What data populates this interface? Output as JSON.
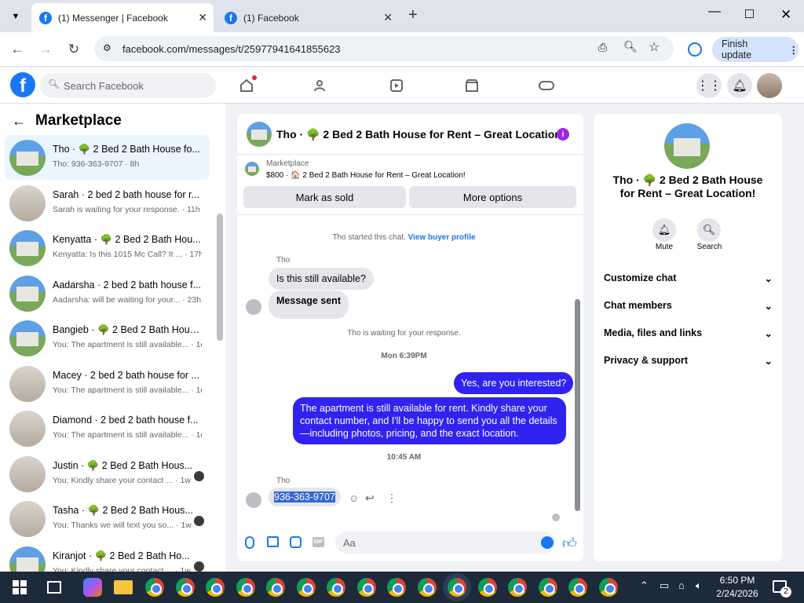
{
  "browser": {
    "tabs": [
      {
        "title": "(1) Messenger | Facebook"
      },
      {
        "title": "(1) Facebook"
      }
    ],
    "url": "facebook.com/messages/t/25977941641855623",
    "finish_update": "Finish update"
  },
  "fb": {
    "search_placeholder": "Search Facebook"
  },
  "left": {
    "title": "Marketplace",
    "conversations": [
      {
        "name": "Tho · 🌳 2 Bed 2 Bath House fo...",
        "preview": "Tho: 936-363-9707 · 8h"
      },
      {
        "name": "Sarah · 2 bed 2 bath house for r...",
        "preview": "Sarah is waiting for your response. · 11h"
      },
      {
        "name": "Kenyatta · 🌳 2 Bed 2 Bath Hou...",
        "preview": "Kenyatta: Is this 1015 Mc Call? It ... · 17h"
      },
      {
        "name": "Aadarsha · 2 bed 2 bath house f...",
        "preview": "Aadarsha: will be waiting for your... · 23h"
      },
      {
        "name": "Bangieb · 🌳 2 Bed 2 Bath Hous...",
        "preview": "You: The apartment is still available... · 1d"
      },
      {
        "name": "Macey · 2 bed 2 bath house for ...",
        "preview": "You: The apartment is still available... · 1d"
      },
      {
        "name": "Diamond · 2 bed 2 bath house f...",
        "preview": "You: The apartment is still available... · 1d"
      },
      {
        "name": "Justin · 🌳 2 Bed 2 Bath Hous...",
        "preview": "You: Kindly share your contact ... · 1w"
      },
      {
        "name": "Tasha · 🌳 2 Bed 2 Bath Hous...",
        "preview": "You: Thanks we will text you so... · 1w"
      },
      {
        "name": "Kiranjot · 🌳 2 Bed 2 Bath Ho...",
        "preview": "You: Kindly share your contact ... · 1w"
      }
    ]
  },
  "chat": {
    "title": "Tho · 🌳 2 Bed 2 Bath House for Rent – Great Location!",
    "listing_label": "Marketplace",
    "listing_detail": "$800 · 🏠 2 Bed 2 Bath House for Rent – Great Location!",
    "mark_sold": "Mark as sold",
    "more_options": "More options",
    "started_text": "Tho started this chat.",
    "view_profile": "View buyer profile",
    "sender_name": "Tho",
    "msg1": "Is this still available?",
    "msg2": "Message sent",
    "waiting": "Tho is waiting for your response.",
    "time1": "Mon 6:39PM",
    "out1": "Yes, are you interested?",
    "out2": "The apartment is still available for rent. Kindly share your contact number, and I'll be happy to send you all the details—including photos, pricing, and the exact location.",
    "time2": "10:45 AM",
    "sender_name2": "Tho",
    "phone": "936-363-9707",
    "composer_placeholder": "Aa"
  },
  "right": {
    "title": "Tho · 🌳 2 Bed 2 Bath House for Rent – Great Location!",
    "mute": "Mute",
    "search": "Search",
    "sections": [
      "Customize chat",
      "Chat members",
      "Media, files and links",
      "Privacy & support"
    ]
  },
  "taskbar": {
    "time": "6:50 PM",
    "date": "2/24/2026",
    "notif_count": "2"
  },
  "colors": {
    "fb_blue": "#1877f2",
    "messenger_purple": "#3023f0"
  }
}
